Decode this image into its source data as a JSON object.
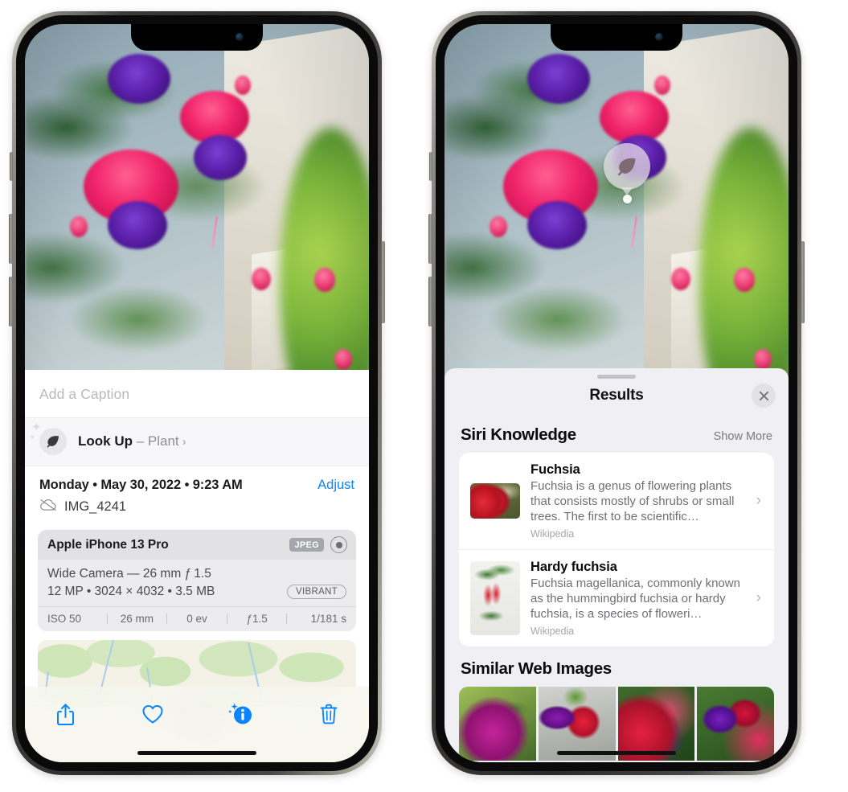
{
  "left_phone": {
    "name": "photos-info-screen",
    "caption_placeholder": "Add a Caption",
    "lookup": {
      "label": "Look Up",
      "dash": " – ",
      "subject": "Plant",
      "chevron": "›",
      "icon": "leaf-icon"
    },
    "meta": {
      "date": "Monday • May 30, 2022 • 9:23 AM",
      "adjust_label": "Adjust",
      "filename": "IMG_4241",
      "cloud_icon": "cloud-slash-icon"
    },
    "exif": {
      "device": "Apple iPhone 13 Pro",
      "format_badge": "JPEG",
      "raw_icon": "raw-circle-icon",
      "lens": "Wide Camera — 26 mm ƒ 1.5",
      "size": "12 MP • 3024 × 4032 • 3.5 MB",
      "style_badge": "VIBRANT",
      "stats": [
        "ISO 50",
        "26 mm",
        "0 ev",
        "ƒ1.5",
        "1/181 s"
      ]
    },
    "toolbar": [
      {
        "name": "share-button",
        "icon": "share-icon"
      },
      {
        "name": "favorite-button",
        "icon": "heart-icon"
      },
      {
        "name": "info-button",
        "icon": "info-sparkle-icon"
      },
      {
        "name": "delete-button",
        "icon": "trash-icon"
      }
    ]
  },
  "right_phone": {
    "name": "visual-lookup-results-screen",
    "leaf_badge_icon": "leaf-icon",
    "sheet": {
      "title": "Results",
      "close_icon": "close-icon",
      "siri_knowledge": {
        "title": "Siri Knowledge",
        "show_more": "Show More",
        "items": [
          {
            "title": "Fuchsia",
            "description": "Fuchsia is a genus of flowering plants that consists mostly of shrubs or small trees. The first to be scientific…",
            "source": "Wikipedia",
            "chevron": "›"
          },
          {
            "title": "Hardy fuchsia",
            "description": "Fuchsia magellanica, commonly known as the hummingbird fuchsia or hardy fuchsia, is a species of floweri…",
            "source": "Wikipedia",
            "chevron": "›"
          }
        ]
      },
      "similar_web_images": {
        "title": "Similar Web Images",
        "count": 4
      }
    }
  },
  "colors": {
    "accent_blue": "#0b84ff",
    "sheet_bg": "#f0eff4",
    "card_bg": "#ffffff",
    "secondary_text": "#8e8e93"
  }
}
